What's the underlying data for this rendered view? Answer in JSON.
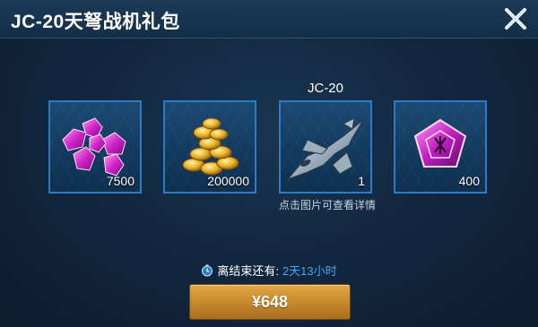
{
  "dialog": {
    "title": "JC-20天弩战机礼包",
    "close_icon": "close-icon"
  },
  "items": [
    {
      "caption": "",
      "icon": "purple-gems-icon",
      "quantity": "7500"
    },
    {
      "caption": "",
      "icon": "gold-coins-icon",
      "quantity": "200000"
    },
    {
      "caption": "JC-20",
      "icon": "fighter-jet-icon",
      "quantity": "1"
    },
    {
      "caption": "",
      "icon": "pentagon-crystal-icon",
      "quantity": "400"
    }
  ],
  "hint": "点击图片可查看详情",
  "timer": {
    "icon": "clock-icon",
    "label": "离结束还有:",
    "remaining": "2天13小时"
  },
  "purchase": {
    "label": "¥648"
  },
  "colors": {
    "background": "#122840",
    "card_border": "#2d7bc4",
    "accent_blue": "#4aa3e8",
    "button_gold": "#c88a2c"
  }
}
